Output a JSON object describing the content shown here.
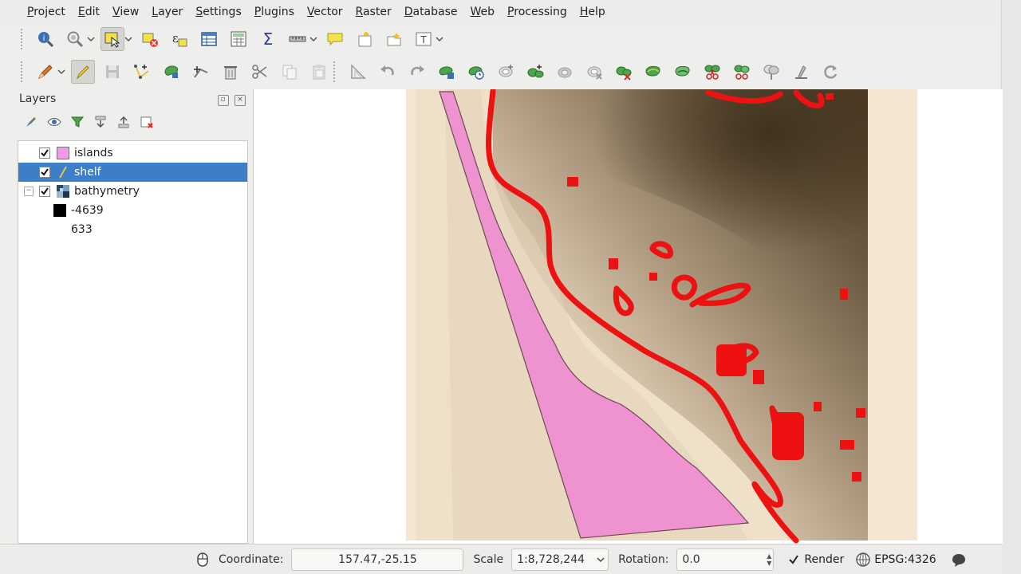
{
  "menu": [
    "Project",
    "Edit",
    "View",
    "Layer",
    "Settings",
    "Plugins",
    "Vector",
    "Raster",
    "Database",
    "Web",
    "Processing",
    "Help"
  ],
  "layers_panel": {
    "title": "Layers",
    "layers": [
      {
        "name": "islands",
        "checked": true,
        "type": "polygon",
        "color": "#f09be6",
        "selected": false
      },
      {
        "name": "shelf",
        "checked": true,
        "type": "line",
        "color": "#e6c04a",
        "selected": true
      },
      {
        "name": "bathymetry",
        "checked": true,
        "type": "raster",
        "selected": false
      }
    ],
    "legend": {
      "min_label": "-4639",
      "max_label": "633",
      "min_color": "#000000",
      "max_color": "#ffffff"
    }
  },
  "map": {
    "background": "#ffffff",
    "raster_light": "#f5e6d2",
    "raster_dark": "#4e3d26",
    "polygon_fill": "#ee93cf",
    "polygon_stroke": "#6b4a53",
    "line_color": "#ee1111"
  },
  "statusbar": {
    "coordinate_label": "Coordinate:",
    "coordinate_value": "157.47,-25.15",
    "scale_label": "Scale",
    "scale_value": "1:8,728,244",
    "rotation_label": "Rotation:",
    "rotation_value": "0.0",
    "render_label": "Render",
    "crs_label": "EPSG:4326"
  }
}
